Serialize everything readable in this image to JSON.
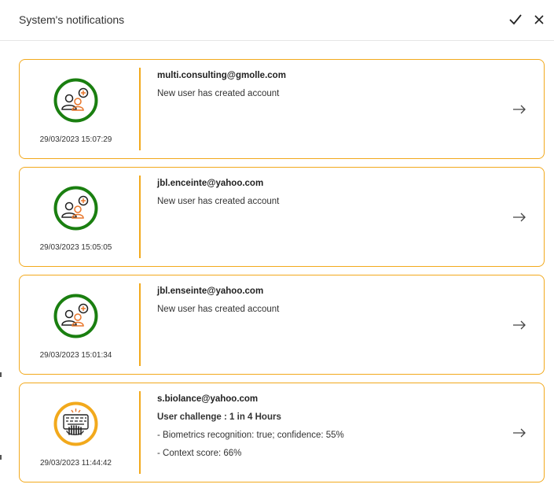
{
  "header": {
    "title": "System's notifications",
    "icons": [
      "checkmark-icon",
      "close-icon"
    ]
  },
  "notifications": [
    {
      "icon": "new-user-icon",
      "icon_color": "#1a7f10",
      "date": "29/03/2023 15:07:29",
      "email": "multi.consulting@gmolle.com",
      "lines": [
        "New user has created account"
      ]
    },
    {
      "icon": "new-user-icon",
      "icon_color": "#1a7f10",
      "date": "29/03/2023 15:05:05",
      "email": "jbl.enceinte@yahoo.com",
      "lines": [
        "New user has created account"
      ]
    },
    {
      "icon": "new-user-icon",
      "icon_color": "#1a7f10",
      "date": "29/03/2023 15:01:34",
      "email": "jbl.enseinte@yahoo.com",
      "lines": [
        "New user has created account"
      ]
    },
    {
      "icon": "keyboard-alert-icon",
      "icon_color": "#f2a91c",
      "date": "29/03/2023 11:44:42",
      "email": "s.biolance@yahoo.com",
      "title": "User challenge : 1 in 4 Hours",
      "lines": [
        "- Biometrics recognition: true; confidence: 55%",
        "- Context score: 66%"
      ]
    }
  ],
  "colors": {
    "card_border": "#f2a91c",
    "accent_orange": "#e8762b",
    "ring_green": "#1a7f10"
  }
}
